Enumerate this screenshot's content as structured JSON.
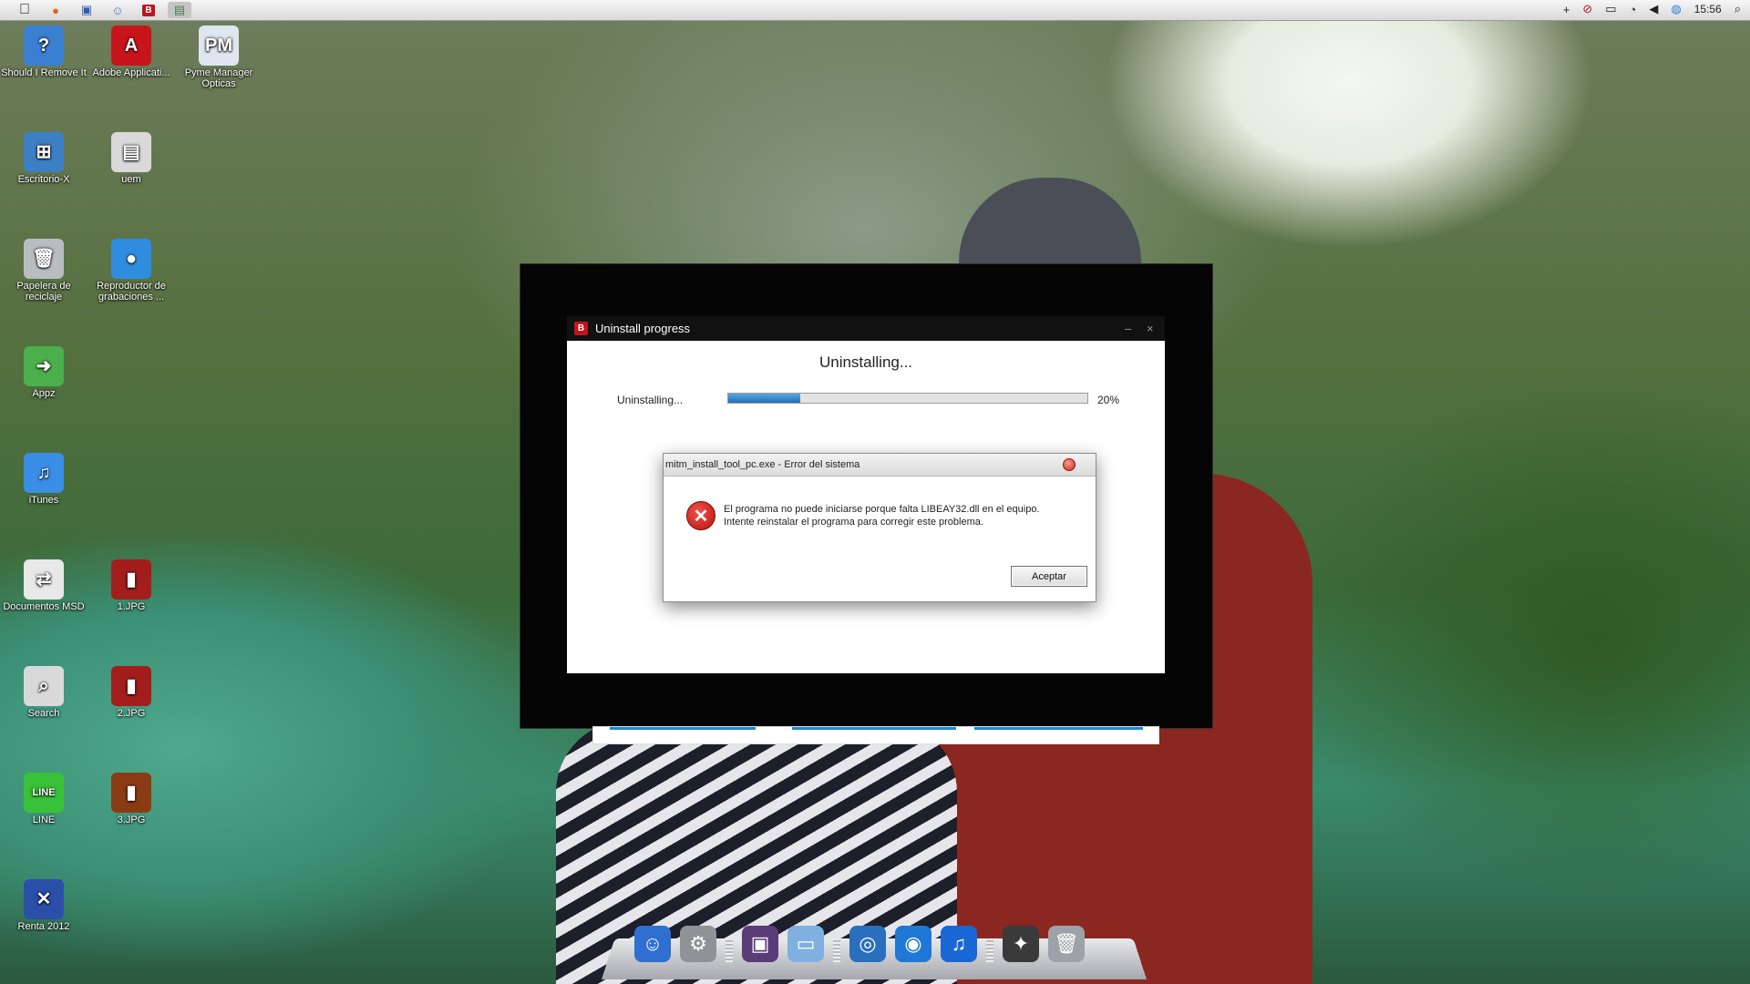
{
  "menubar": {
    "apple": "",
    "running_apps": [
      "firefox-icon",
      "outlook-icon",
      "finder-face-icon",
      "bitdefender-icon",
      "window-icon"
    ],
    "status_icons": [
      "plus-icon",
      "no-network-icon",
      "battery-icon",
      "wifi-icon",
      "volume-icon",
      "globe-icon"
    ],
    "clock": "15:56"
  },
  "desktop": {
    "icons": [
      {
        "label": "Should I Remove It",
        "glyph": "?",
        "color": "#3a7fd0"
      },
      {
        "label": "Adobe Applicati...",
        "glyph": "A",
        "color": "#c8151b"
      },
      {
        "label": "Pyme Manager Opticas",
        "glyph": "PM",
        "color": "#dfe6ef"
      },
      {
        "label": "Escritorio-X",
        "glyph": "⊞",
        "color": "#3d7fc4"
      },
      {
        "label": "uem",
        "glyph": "▤",
        "color": "#d9d9d9"
      },
      {
        "label": "Papelera de reciclaje",
        "glyph": "🗑",
        "color": "#b9bcc0"
      },
      {
        "label": "Reproductor de grabaciones ...",
        "glyph": "●",
        "color": "#2f8de0"
      },
      {
        "label": "Appz",
        "glyph": "➜",
        "color": "#4bb04b"
      },
      {
        "label": "iTunes",
        "glyph": "♫",
        "color": "#3a8ee6"
      },
      {
        "label": "Documentos MSD",
        "glyph": "⇄",
        "color": "#e8e8e8"
      },
      {
        "label": "1.JPG",
        "glyph": "▮",
        "color": "#a31d1d"
      },
      {
        "label": "Search",
        "glyph": "⌕",
        "color": "#d9d9d9"
      },
      {
        "label": "2.JPG",
        "glyph": "▮",
        "color": "#a31d1d"
      },
      {
        "label": "LINE",
        "glyph": "LINE",
        "color": "#39c239"
      },
      {
        "label": "3.JPG",
        "glyph": "▮",
        "color": "#8a3b14"
      },
      {
        "label": "Renta 2012",
        "glyph": "✕",
        "color": "#2a4fa8"
      }
    ]
  },
  "uninstall_dialog": {
    "logo": "B",
    "title": "Uninstall progress",
    "minimize": "–",
    "close": "×",
    "heading": "Uninstalling...",
    "progress_label": "Uninstalling...",
    "progress_fraction": 0.2,
    "progress_text": "20%"
  },
  "error_dialog": {
    "title": "mitm_install_tool_pc.exe - Error del sistema",
    "icon": "✕",
    "message_line1": "El programa no puede iniciarse porque falta LIBEAY32.dll en el equipo.",
    "message_line2": "Intente reinstalar el programa para corregir este problema.",
    "button": "Aceptar"
  },
  "dock": {
    "items": [
      {
        "name": "finder",
        "glyph": "☺",
        "color": "#2f6fd0"
      },
      {
        "name": "system-preferences",
        "glyph": "⚙",
        "color": "#8f9297"
      },
      {
        "name": "sep"
      },
      {
        "name": "desktop-screen",
        "glyph": "▣",
        "color": "#5a3c78"
      },
      {
        "name": "folder",
        "glyph": "▭",
        "color": "#7fb0e0"
      },
      {
        "name": "sep"
      },
      {
        "name": "network-globe",
        "glyph": "◎",
        "color": "#2a6fbe"
      },
      {
        "name": "browser-globe",
        "glyph": "◉",
        "color": "#1f78d6"
      },
      {
        "name": "itunes",
        "glyph": "♫",
        "color": "#1a67d6"
      },
      {
        "name": "sep"
      },
      {
        "name": "dashboard",
        "glyph": "✦",
        "color": "#3a3a3a"
      },
      {
        "name": "trash",
        "glyph": "🗑",
        "color": "#9ea2a8"
      }
    ]
  }
}
